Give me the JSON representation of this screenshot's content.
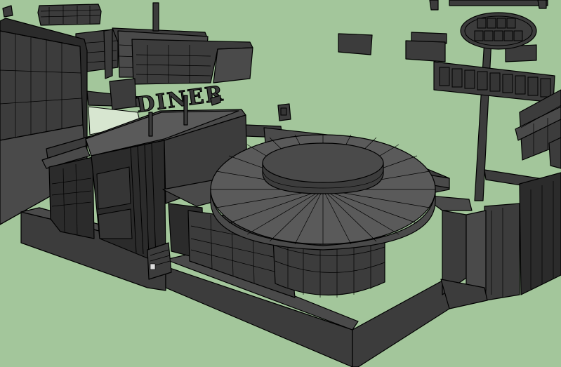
{
  "scene": {
    "kind": "3d-model-viewport",
    "style": "monochrome shaded with black edges",
    "background_color": "#a3c69b",
    "shading_color": "#3c3c3c",
    "edge_color": "#000000"
  },
  "sign": {
    "text": "DINER"
  }
}
